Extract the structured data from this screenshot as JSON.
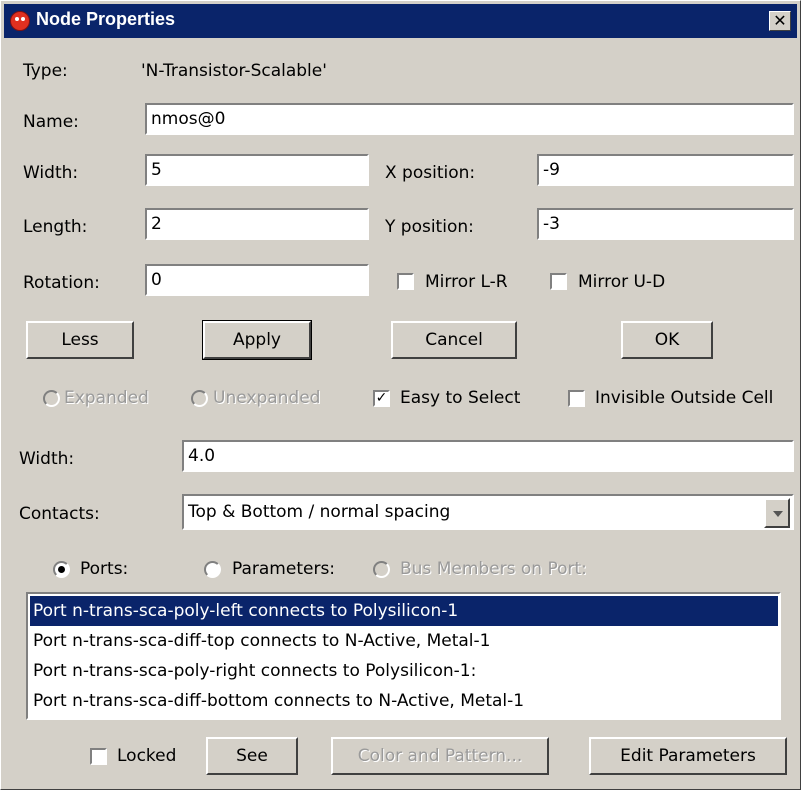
{
  "window": {
    "title": "Node Properties",
    "close_label": "✕"
  },
  "type_row": {
    "label": "Type:",
    "value": "'N-Transistor-Scalable'"
  },
  "name_row": {
    "label": "Name:",
    "value": "nmos@0"
  },
  "width_row": {
    "label": "Width:",
    "value": "5"
  },
  "length_row": {
    "label": "Length:",
    "value": "2"
  },
  "rotation_row": {
    "label": "Rotation:",
    "value": "0"
  },
  "xpos_row": {
    "label": "X position:",
    "value": "-9"
  },
  "ypos_row": {
    "label": "Y position:",
    "value": "-3"
  },
  "mirror": {
    "lr_label": "Mirror L-R",
    "lr_checked": false,
    "ud_label": "Mirror U-D",
    "ud_checked": false
  },
  "buttons": {
    "less": "Less",
    "apply": "Apply",
    "cancel": "Cancel",
    "ok": "OK"
  },
  "expansion": {
    "expanded": "Expanded",
    "unexpanded": "Unexpanded",
    "easy_select": "Easy to Select",
    "easy_select_checked": true,
    "invisible_outside": "Invisible Outside Cell",
    "invisible_outside_checked": false
  },
  "gate_width": {
    "label": "Width:",
    "value": "4.0"
  },
  "contacts": {
    "label": "Contacts:",
    "selected": "Top & Bottom / normal spacing"
  },
  "view_mode": {
    "ports": "Ports:",
    "parameters": "Parameters:",
    "bus_members": "Bus Members on Port:",
    "selected": "ports"
  },
  "port_list": [
    "Port n-trans-sca-poly-left connects to Polysilicon-1",
    "Port n-trans-sca-diff-top connects to N-Active, Metal-1",
    "Port n-trans-sca-poly-right connects to Polysilicon-1:",
    "Port n-trans-sca-diff-bottom connects to N-Active, Metal-1"
  ],
  "port_list_selected_index": 0,
  "bottom": {
    "locked": "Locked",
    "locked_checked": false,
    "see": "See",
    "color_pattern": "Color and Pattern...",
    "edit_params": "Edit Parameters"
  },
  "colors": {
    "titlebar": "#0a246a",
    "selection": "#0a246a",
    "face": "#d4d0c8"
  },
  "icons": {
    "app": "electric-app-icon",
    "close": "close-icon",
    "dropdown": "chevron-down-icon"
  }
}
